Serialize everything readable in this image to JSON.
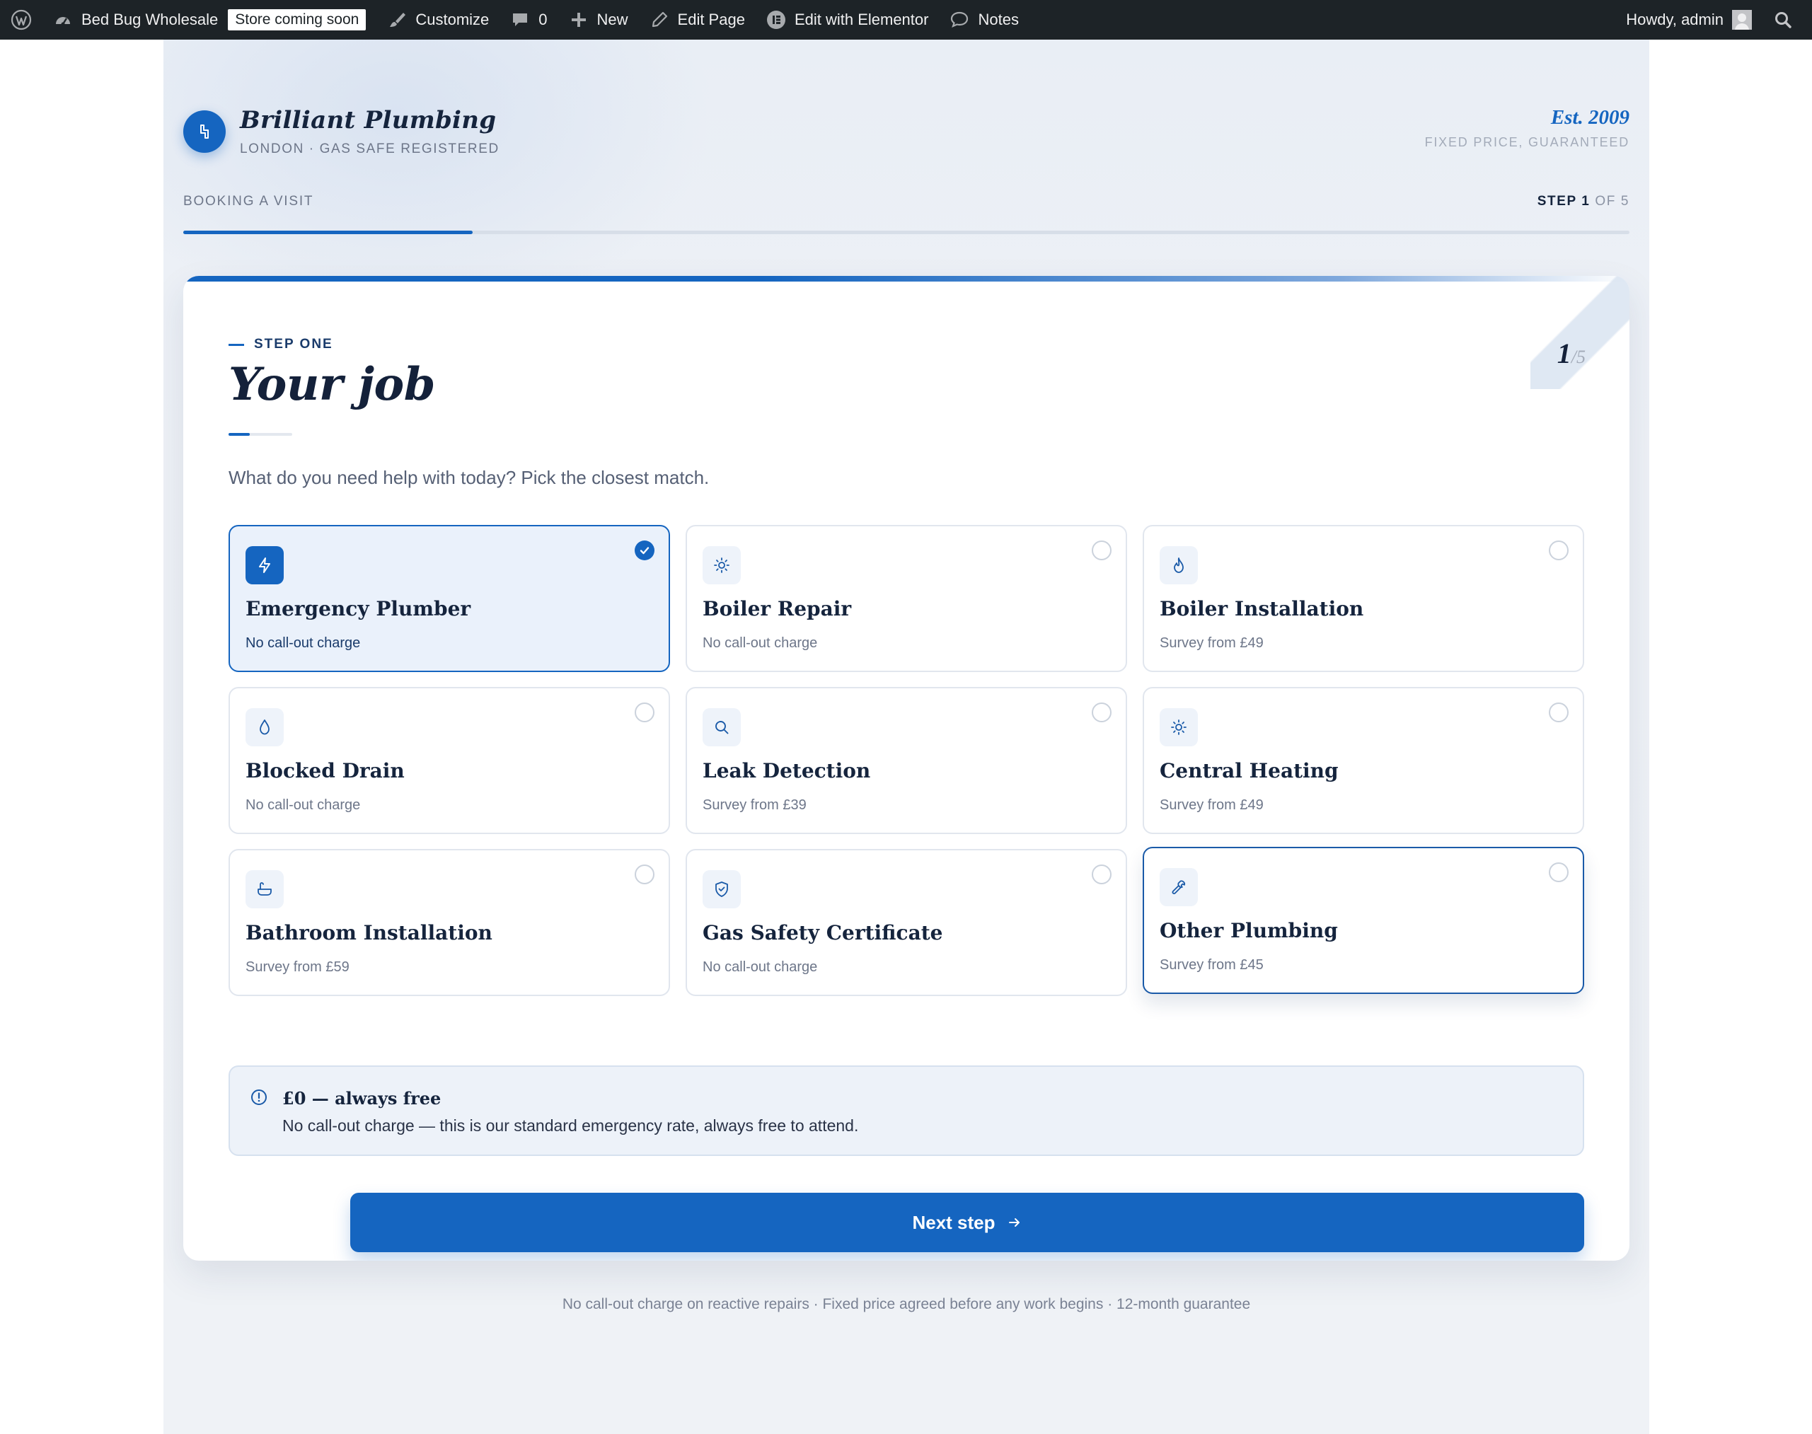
{
  "admin_bar": {
    "site_name": "Bed Bug Wholesale",
    "store_badge": "Store coming soon",
    "customize": "Customize",
    "comments_count": "0",
    "new": "New",
    "edit_page": "Edit Page",
    "edit_elementor": "Edit with Elementor",
    "notes": "Notes",
    "howdy": "Howdy, admin"
  },
  "header": {
    "brand_name": "Brilliant Plumbing",
    "brand_sub": "LONDON · GAS SAFE REGISTERED",
    "est": "Est. 2009",
    "est_sub": "FIXED PRICE, GUARANTEED"
  },
  "progress": {
    "label": "BOOKING A VISIT",
    "step_word": "STEP",
    "step_current": "1",
    "step_total_text": "OF 5",
    "fraction": 0.2
  },
  "card": {
    "eyebrow": "STEP ONE",
    "title": "Your job",
    "counter_num": "1",
    "counter_of": "/5",
    "lead": "What do you need help with today? Pick the closest match."
  },
  "options": [
    {
      "title": "Emergency Plumber",
      "price": "No call-out charge",
      "icon": "bolt-icon",
      "selected": true
    },
    {
      "title": "Boiler Repair",
      "price": "No call-out charge",
      "icon": "sun-icon",
      "selected": false
    },
    {
      "title": "Boiler Installation",
      "price": "Survey from £49",
      "icon": "flame-icon",
      "selected": false
    },
    {
      "title": "Blocked Drain",
      "price": "No call-out charge",
      "icon": "droplet-icon",
      "selected": false
    },
    {
      "title": "Leak Detection",
      "price": "Survey from £39",
      "icon": "search-icon",
      "selected": false
    },
    {
      "title": "Central Heating",
      "price": "Survey from £49",
      "icon": "sun-icon",
      "selected": false
    },
    {
      "title": "Bathroom Installation",
      "price": "Survey from £59",
      "icon": "bath-icon",
      "selected": false
    },
    {
      "title": "Gas Safety Certificate",
      "price": "No call-out charge",
      "icon": "shield-check-icon",
      "selected": false
    },
    {
      "title": "Other Plumbing",
      "price": "Survey from £45",
      "icon": "wrench-icon",
      "selected": false
    }
  ],
  "notice": {
    "title": "£0 — always free",
    "text": "No call-out charge — this is our standard emergency rate, always free to attend."
  },
  "next_button": "Next step",
  "footer_note": "No call-out charge on reactive repairs · Fixed price agreed before any work begins · 12-month guarantee",
  "colors": {
    "accent": "#1565c0",
    "admin_bar": "#1d2327",
    "heading": "#15243d",
    "selected_bg": "#eaf1fb"
  }
}
